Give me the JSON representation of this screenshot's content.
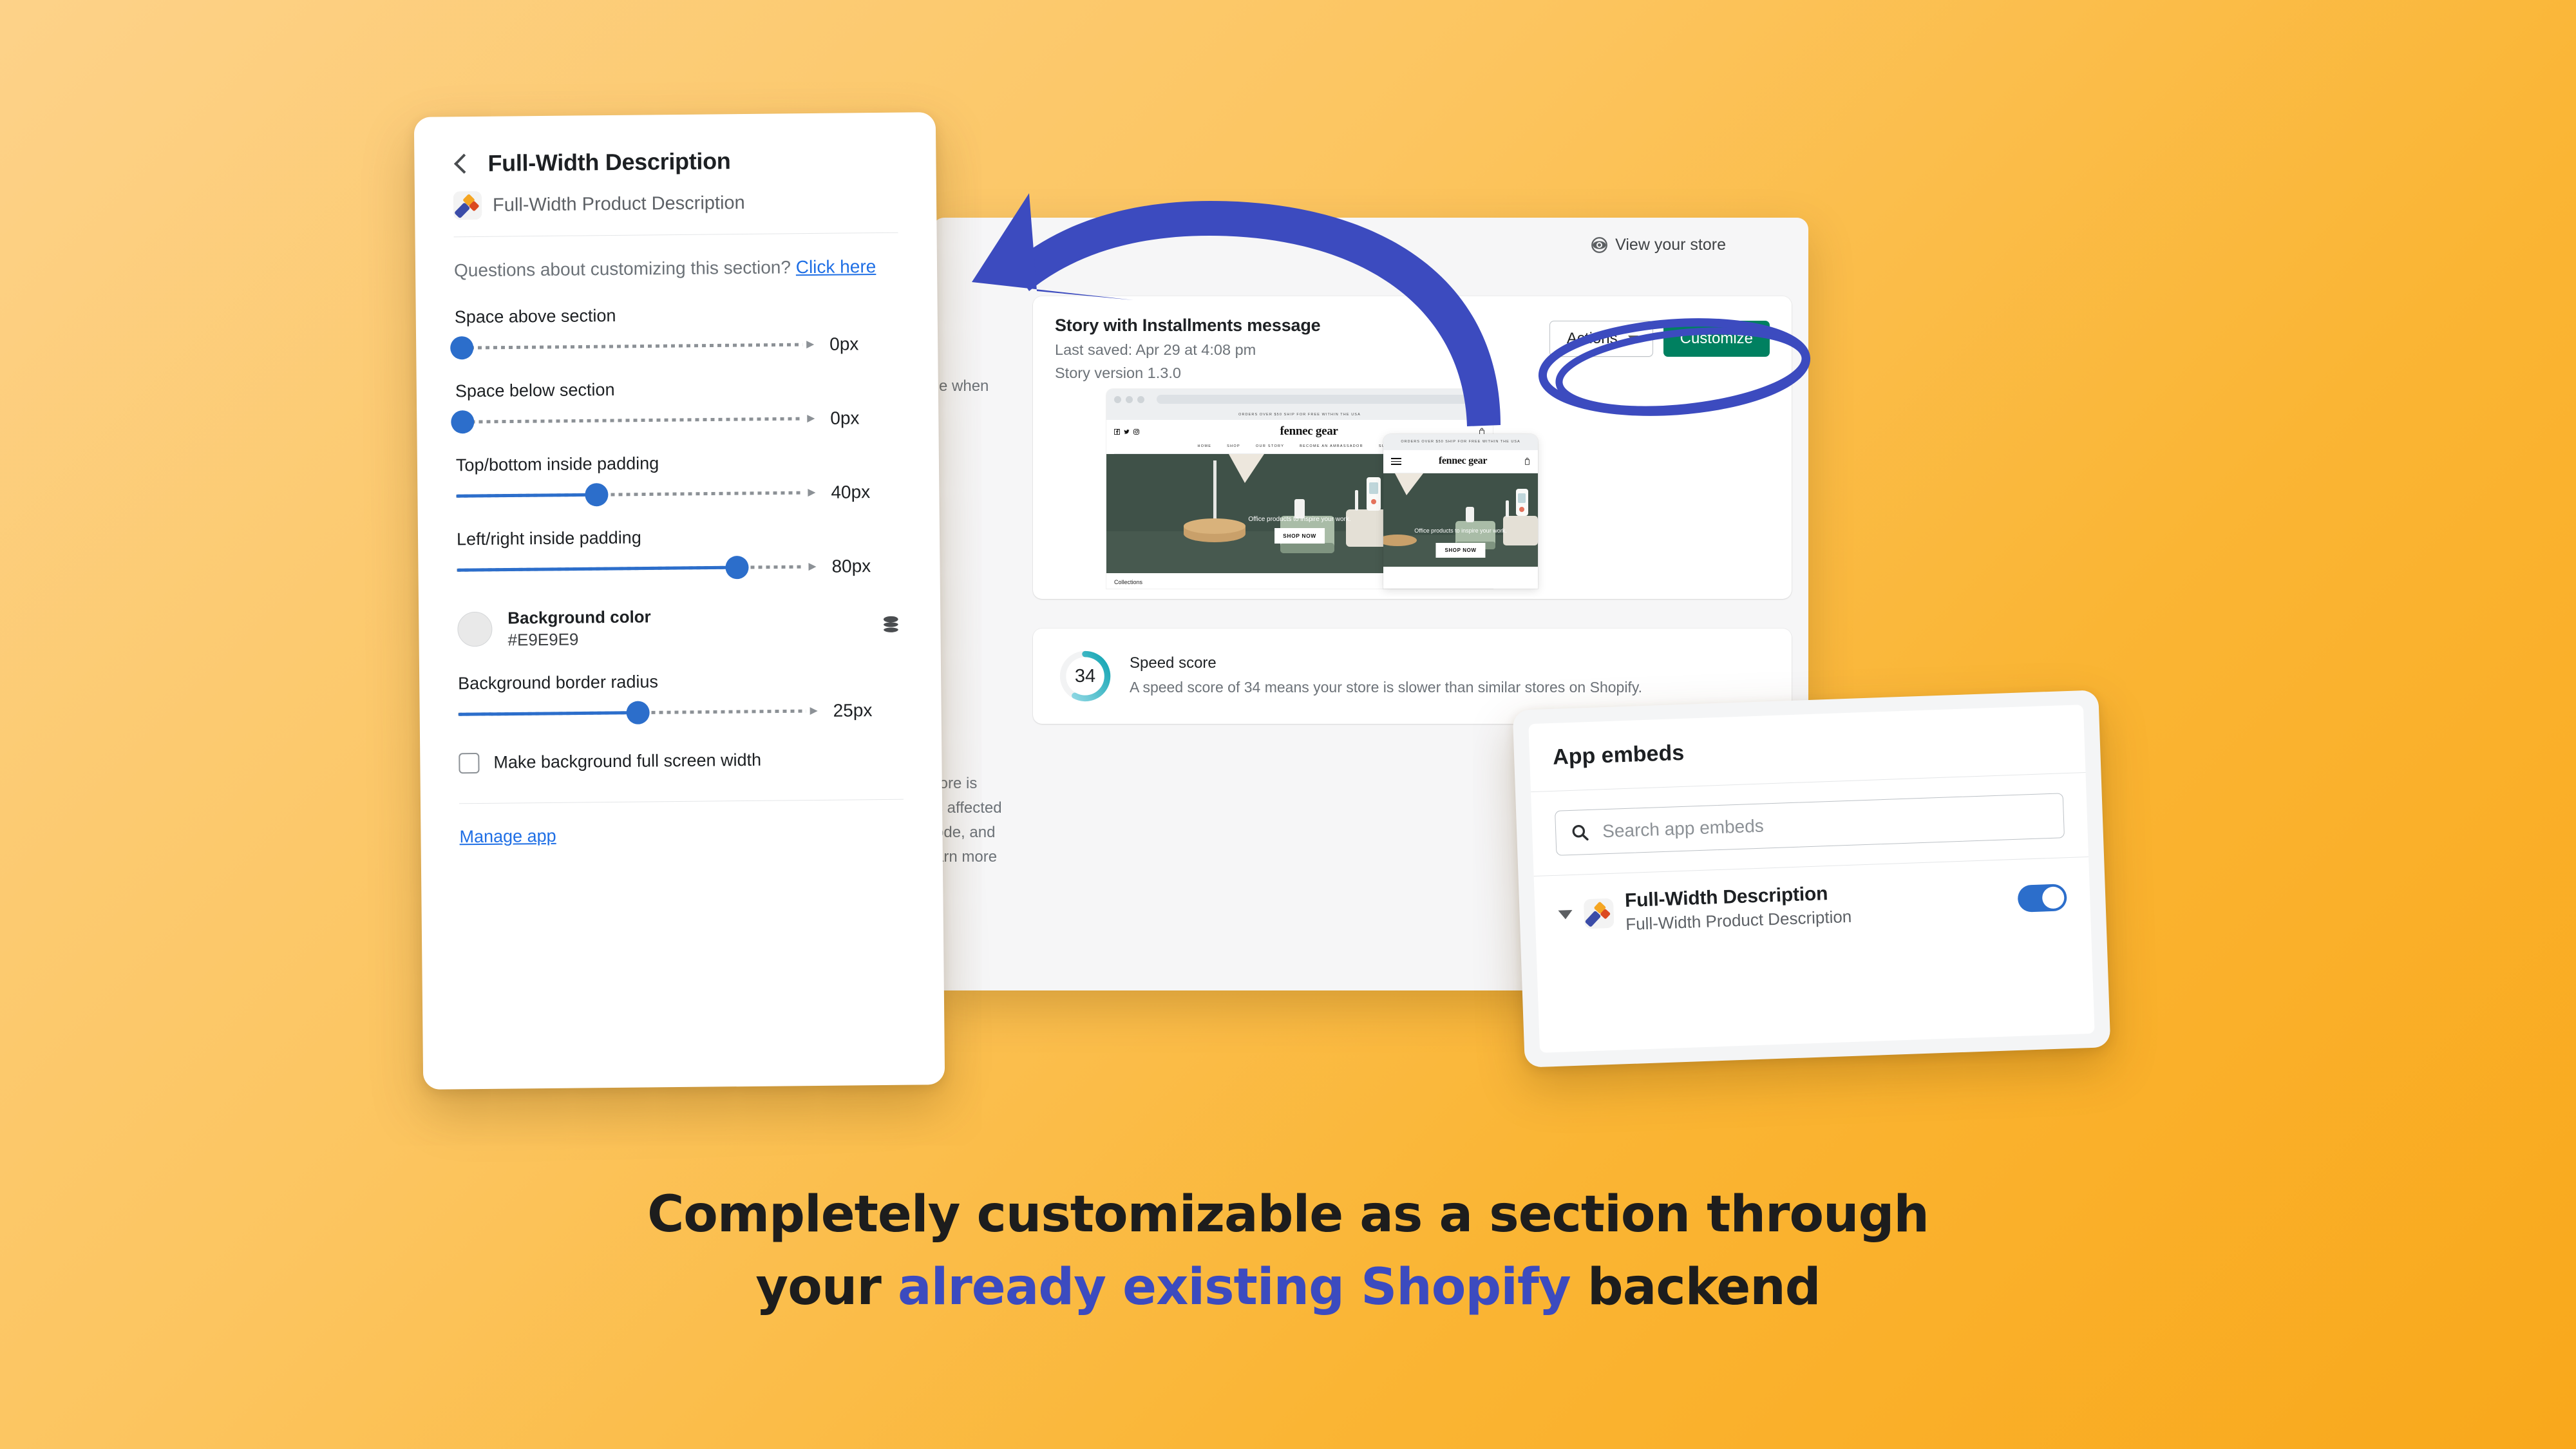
{
  "background": {
    "gradient_from": "#FDD289",
    "gradient_to": "#F9A81B"
  },
  "settings_panel": {
    "back_icon": "chevron-left-icon",
    "title": "Full-Width Description",
    "app_icon": "full-width-description-app-icon",
    "app_name": "Full-Width Product Description",
    "help_text": "Questions about customizing this section?",
    "help_link": "Click here",
    "fields": [
      {
        "label": "Space above section",
        "value": "0px",
        "fill_percent": 0
      },
      {
        "label": "Space below section",
        "value": "0px",
        "fill_percent": 0
      },
      {
        "label": "Top/bottom inside padding",
        "value": "40px",
        "fill_percent": 39
      },
      {
        "label": "Left/right inside padding",
        "value": "80px",
        "fill_percent": 78
      }
    ],
    "color_field": {
      "label": "Background color",
      "hex": "#E9E9E9",
      "swatch_color": "#E9E9E9",
      "icon": "layers-stack-icon"
    },
    "radius_field": {
      "label": "Background border radius",
      "value": "25px",
      "fill_percent": 50
    },
    "checkbox": {
      "label": "Make background full screen width",
      "checked": false
    },
    "manage_link": "Manage app"
  },
  "admin_window": {
    "view_store": {
      "icon": "eye-icon",
      "label": "View your store"
    },
    "story_card": {
      "title": "Story with Installments message",
      "last_saved": "Last saved: Apr 29 at 4:08 pm",
      "version": "Story version 1.3.0",
      "actions_button": "Actions",
      "customize_button": "Customize",
      "customize_color": "#008060"
    },
    "preview": {
      "announcement": "ORDERS OVER $50 SHIP FOR FREE WITHIN THE USA",
      "announcement_mobile": "ORDERS OVER $50 SHIP FOR FREE WITHIN THE USA",
      "brand": "fennec gear",
      "nav": [
        "HOME",
        "SHOP",
        "OUR STORY",
        "BECOME AN AMBASSADOR",
        "SUPPORT"
      ],
      "hero_caption": "Office products to inspire your work.",
      "hero_button": "SHOP NOW",
      "collections_label": "Collections"
    },
    "fragments": {
      "when": "e when",
      "block": "tore is\ns affected\node, and\narn more"
    },
    "speed_card": {
      "score": "34",
      "title": "Speed score",
      "description": "A speed score of 34 means your store is slower than similar stores on Shopify."
    }
  },
  "app_embeds_panel": {
    "title": "App embeds",
    "search_icon": "search-icon",
    "search_placeholder": "Search app embeds",
    "embed": {
      "expand_icon": "triangle-down-icon",
      "icon": "full-width-description-app-icon",
      "name": "Full-Width Description",
      "subtitle": "Full-Width Product Description",
      "toggle_on": true,
      "toggle_color": "#2C6ECB"
    }
  },
  "annotations": {
    "arrow_color": "#3C4BBF",
    "circle_color": "#3C4BBF"
  },
  "caption": {
    "line1": "Completely customizable as a section through",
    "line2_pre": "your ",
    "line2_highlight": "already existing Shopify",
    "line2_post": " backend",
    "highlight_color": "#3C4BBF"
  }
}
